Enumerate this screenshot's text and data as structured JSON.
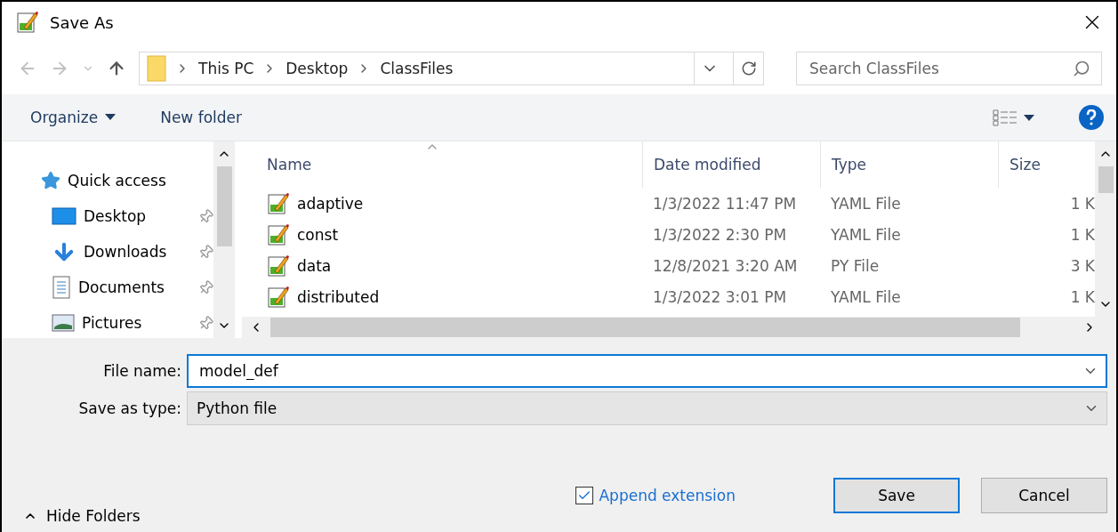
{
  "window": {
    "title": "Save As"
  },
  "address": {
    "crumbs": [
      "This PC",
      "Desktop",
      "ClassFiles"
    ]
  },
  "search": {
    "placeholder": "Search ClassFiles"
  },
  "toolbar": {
    "organize": "Organize",
    "new_folder": "New folder"
  },
  "navigation": {
    "items": [
      {
        "label": "Quick access",
        "kind": "star",
        "pinned": false
      },
      {
        "label": "Desktop",
        "kind": "desktop",
        "pinned": true
      },
      {
        "label": "Downloads",
        "kind": "download",
        "pinned": true
      },
      {
        "label": "Documents",
        "kind": "document",
        "pinned": true
      },
      {
        "label": "Pictures",
        "kind": "pictures",
        "pinned": true
      }
    ]
  },
  "table": {
    "columns": [
      "Name",
      "Date modified",
      "Type",
      "Size"
    ],
    "rows": [
      {
        "name": "adaptive",
        "date": "1/3/2022 11:47 PM",
        "type": "YAML File",
        "size": "1 K"
      },
      {
        "name": "const",
        "date": "1/3/2022 2:30 PM",
        "type": "YAML File",
        "size": "1 K"
      },
      {
        "name": "data",
        "date": "12/8/2021 3:20 AM",
        "type": "PY File",
        "size": "3 K"
      },
      {
        "name": "distributed",
        "date": "1/3/2022 3:01 PM",
        "type": "YAML File",
        "size": "1 K"
      }
    ]
  },
  "form": {
    "file_name_label": "File name:",
    "file_name": "model_def",
    "type_label": "Save as type:",
    "type": "Python file"
  },
  "footer": {
    "hide_folders": "Hide Folders",
    "append_extension": {
      "label": "Append extension",
      "checked": true
    },
    "buttons": [
      "Save",
      "Cancel"
    ]
  }
}
